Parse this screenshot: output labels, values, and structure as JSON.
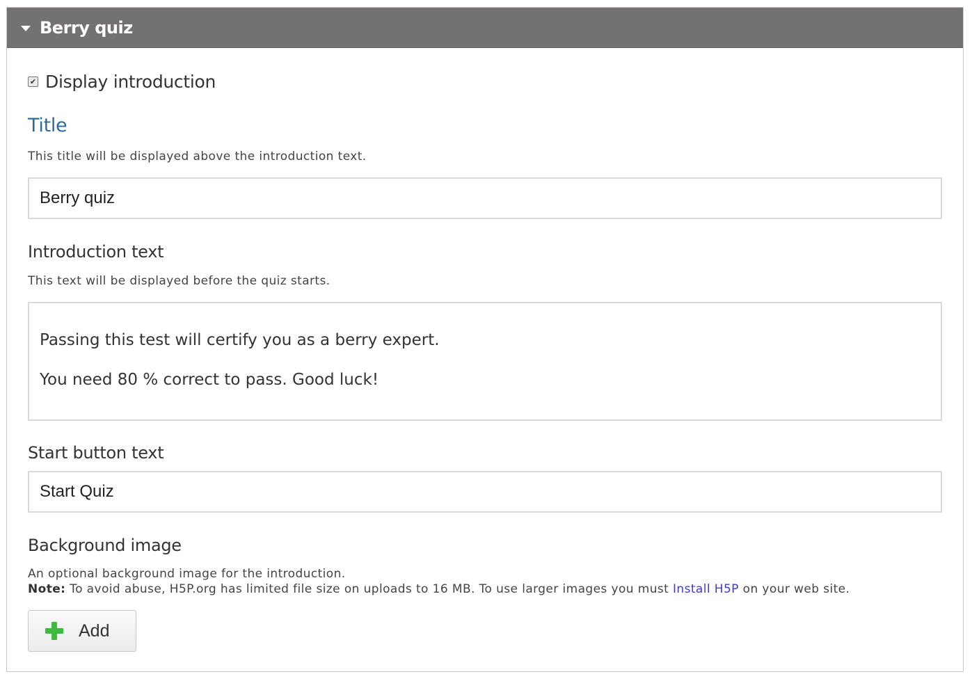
{
  "section": {
    "title": "Berry quiz"
  },
  "display_introduction": {
    "label": "Display introduction",
    "checked": true
  },
  "title_field": {
    "label": "Title",
    "description": "This title will be displayed above the introduction text.",
    "value": "Berry quiz"
  },
  "intro_field": {
    "label": "Introduction text",
    "description": "This text will be displayed before the quiz starts.",
    "paragraphs": [
      "Passing this test will certify you as a berry expert.",
      "You need 80 % correct to pass. Good luck!"
    ]
  },
  "start_button_field": {
    "label": "Start button text",
    "value": "Start Quiz"
  },
  "background_field": {
    "label": "Background image",
    "description": "An optional background image for the introduction.",
    "note_label": "Note:",
    "note_text_before": " To avoid abuse, H5P.org has limited file size on uploads to 16 MB. To use larger images you must ",
    "note_link": "Install H5P",
    "note_text_after": " on your web site.",
    "add_button": "Add"
  },
  "colors": {
    "header_bg": "#737172",
    "title_label": "#2f6c99",
    "link": "#3d3bd6",
    "add_icon": "#3fba40"
  }
}
